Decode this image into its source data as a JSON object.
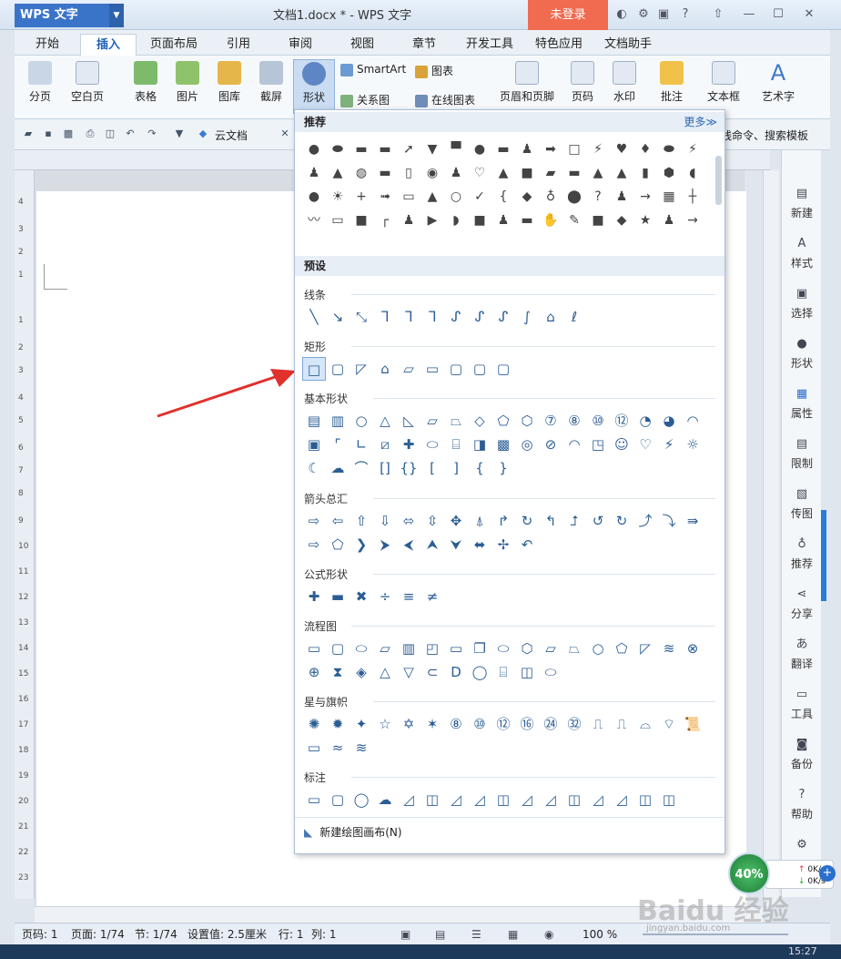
{
  "app": {
    "logo": "WPS 文字",
    "doc_title": "文档1.docx * - WPS 文字",
    "login": "未登录"
  },
  "tabs": [
    "开始",
    "插入",
    "页面布局",
    "引用",
    "审阅",
    "视图",
    "章节",
    "开发工具",
    "特色应用",
    "文档助手"
  ],
  "active_tab": "插入",
  "ribbon": {
    "page_break": "分页",
    "blank_page": "空白页",
    "table": "表格",
    "picture": "图片",
    "gallery": "图库",
    "screenshot": "截屏",
    "shape": "形状",
    "smartart": "SmartArt",
    "chart": "图表",
    "relation": "关系图",
    "online_chart": "在线图表",
    "header_footer": "页眉和页脚",
    "page_num": "页码",
    "watermark": "水印",
    "comment": "批注",
    "textbox": "文本框",
    "wordart": "艺术字"
  },
  "quickbar": {
    "cloud_doc": "云文档",
    "search_hint": "线命令、搜索模板"
  },
  "shape_panel": {
    "recommend": "推荐",
    "more": "更多≫",
    "preset": "预设",
    "sections": [
      "线条",
      "矩形",
      "基本形状",
      "箭头总汇",
      "公式形状",
      "流程图",
      "星与旗帜",
      "标注"
    ],
    "new_canvas": "新建绘图画布(N)"
  },
  "sidebar": [
    "新建",
    "样式",
    "选择",
    "形状",
    "属性",
    "限制",
    "传图",
    "推荐",
    "分享",
    "翻译",
    "工具",
    "备份",
    "帮助"
  ],
  "status": {
    "page_code": "页码: 1",
    "page": "页面: 1/74",
    "section": "节: 1/74",
    "setting": "设置值: 2.5厘米",
    "row": "行: 1",
    "col": "列: 1",
    "zoom": "100 %"
  },
  "network": {
    "percent": "40%",
    "up": "0K/s",
    "down": "0K/s"
  },
  "watermark": {
    "main": "Baidu 经验",
    "sub": "jingyan.baidu.com"
  },
  "taskbar": {
    "time": "15:27"
  }
}
